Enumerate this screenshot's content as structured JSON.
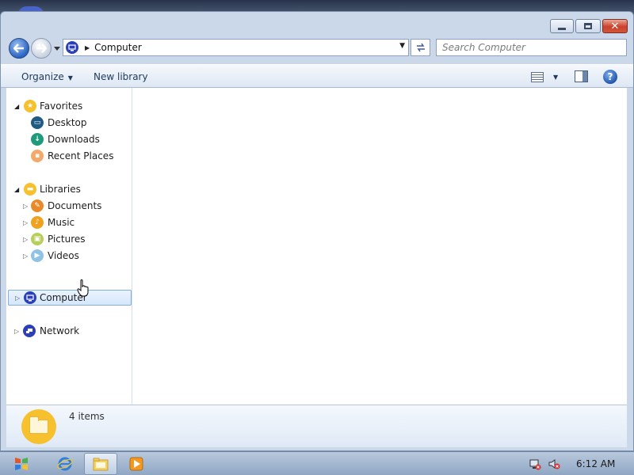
{
  "window": {
    "controls": {
      "minimize": "minimize",
      "maximize": "maximize",
      "close": "✕"
    }
  },
  "address_bar": {
    "location": "Computer",
    "search_placeholder": "Search Computer"
  },
  "command_bar": {
    "organize_label": "Organize",
    "new_library_label": "New library"
  },
  "nav_pane": {
    "favorites": {
      "label": "Favorites",
      "items": [
        {
          "label": "Desktop",
          "icon": "desktop-icon"
        },
        {
          "label": "Downloads",
          "icon": "downloads-icon"
        },
        {
          "label": "Recent Places",
          "icon": "recent-places-icon"
        }
      ]
    },
    "libraries": {
      "label": "Libraries",
      "items": [
        {
          "label": "Documents",
          "icon": "documents-icon"
        },
        {
          "label": "Music",
          "icon": "music-icon"
        },
        {
          "label": "Pictures",
          "icon": "pictures-icon"
        },
        {
          "label": "Videos",
          "icon": "videos-icon"
        }
      ]
    },
    "computer": {
      "label": "Computer",
      "selected": true
    },
    "network": {
      "label": "Network"
    }
  },
  "details_pane": {
    "item_count": "4 items"
  },
  "taskbar": {
    "clock": "6:12 AM"
  },
  "colors": {
    "window_frame": "#cad8ea",
    "selection": "#d5e7fb",
    "folder_yellow": "#f6c12c",
    "close_red": "#c9412c"
  }
}
